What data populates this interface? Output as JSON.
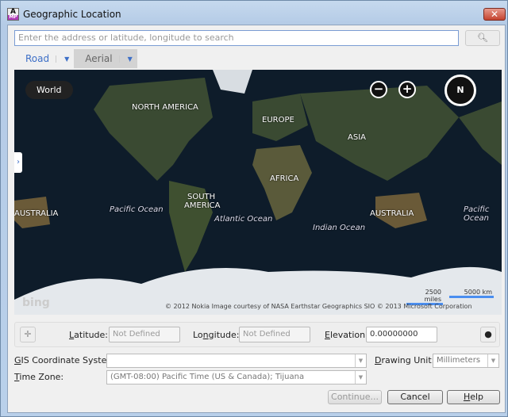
{
  "window": {
    "title": "Geographic Location",
    "app_icon": "autocad-map-icon",
    "close_label": "✕"
  },
  "search": {
    "placeholder": "Enter the address or latitude, longitude to search",
    "icon": "search-icon"
  },
  "tabs": [
    {
      "label": "Road"
    },
    {
      "label": "Aerial"
    }
  ],
  "map": {
    "world_button": "World",
    "zoom_out": "−",
    "zoom_in": "+",
    "compass": "N",
    "labels": {
      "north_america": "NORTH AMERICA",
      "europe": "EUROPE",
      "asia": "ASIA",
      "africa": "AFRICA",
      "south_america_1": "SOUTH",
      "south_america_2": "AMERICA",
      "australia_left": "AUSTRALIA",
      "australia_right": "AUSTRALIA",
      "pacific_left": "Pacific Ocean",
      "pacific_right": "Pacific Ocean",
      "atlantic": "Atlantic Ocean",
      "indian": "Indian Ocean"
    },
    "scale_miles": "2500 miles",
    "scale_km": "5000 km",
    "logo": "bing",
    "credits": "© 2012 Nokia    Image courtesy of NASA    Earthstar Geographics SIO    © 2013 Microsoft Corporation"
  },
  "coords": {
    "latitude_label": {
      "u": "L",
      "rest": "atitude:"
    },
    "latitude_value": "Not Defined",
    "longitude_label": {
      "pre": "Lo",
      "u": "n",
      "rest": "gitude:"
    },
    "longitude_value": "Not Defined",
    "elevation_label": {
      "u": "E",
      "rest": "levation:"
    },
    "elevation_value": "0.00000000"
  },
  "gis": {
    "label": {
      "u": "G",
      "rest": "IS Coordinate System:"
    },
    "value": ""
  },
  "drawing_unit": {
    "label": {
      "u": "D",
      "rest": "rawing Unit:"
    },
    "value": "Millimeters"
  },
  "time_zone": {
    "label": {
      "u": "T",
      "rest": "ime Zone:"
    },
    "value": "(GMT-08:00) Pacific Time (US & Canada); Tijuana"
  },
  "buttons": {
    "continue": "Continue...",
    "cancel": "Cancel",
    "help": {
      "u": "H",
      "rest": "elp"
    }
  }
}
